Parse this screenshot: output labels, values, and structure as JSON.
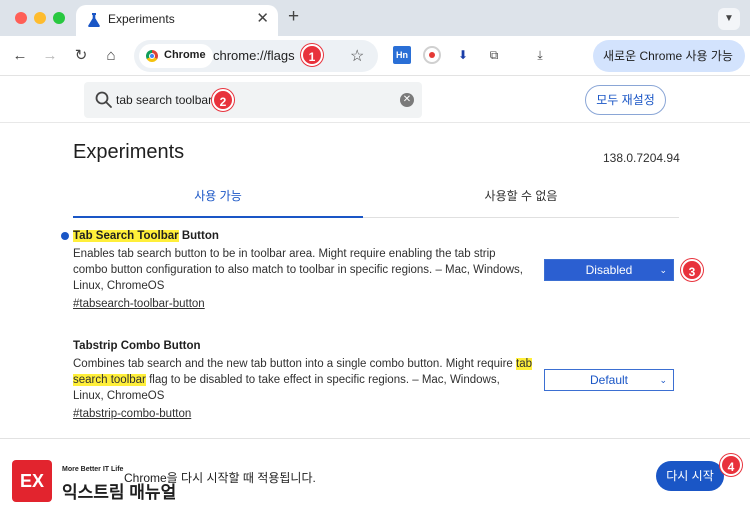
{
  "window": {
    "tab_title": "Experiments",
    "new_tab_symbol": "+",
    "close_symbol": "✕"
  },
  "toolbar": {
    "chip_label": "Chrome",
    "url": "chrome://flags",
    "profile_button": "새로운 Chrome 사용 가능"
  },
  "search": {
    "value": "tab search toolbar",
    "reset_label": "모두 재설정"
  },
  "page": {
    "title": "Experiments",
    "version": "138.0.7204.94",
    "tabs": [
      {
        "label": "사용 가능",
        "active": true
      },
      {
        "label": "사용할 수 없음",
        "active": false
      }
    ]
  },
  "flags": [
    {
      "name_highlight": "Tab Search Toolbar",
      "name_rest": " Button",
      "description": "Enables tab search button to be in toolbar area. Might require enabling the tab strip combo button configuration to also match to toolbar in specific regions. – Mac, Windows, Linux, ChromeOS",
      "link": "#tabsearch-toolbar-button",
      "state": "Disabled"
    },
    {
      "name": "Tabstrip Combo Button",
      "description_before": "Combines tab search and the new tab button into a single combo button. Might require ",
      "description_highlight": "tab search toolbar",
      "description_after": " flag to be disabled to take effect in specific regions. – Mac, Windows, Linux, ChromeOS",
      "link": "#tabstrip-combo-button",
      "state": "Default"
    }
  ],
  "footer": {
    "message": "Chrome을 다시 시작할 때 적용됩니다.",
    "restart_label": "다시 시작"
  },
  "watermark": {
    "mark": "EX",
    "tagline": "More Better IT Life",
    "name": "익스트림 매뉴얼"
  },
  "steps": [
    "1",
    "2",
    "3",
    "4"
  ],
  "colors": {
    "accent": "#1a56c6",
    "highlight": "#ffef3a",
    "step_marker": "#e8323c"
  }
}
